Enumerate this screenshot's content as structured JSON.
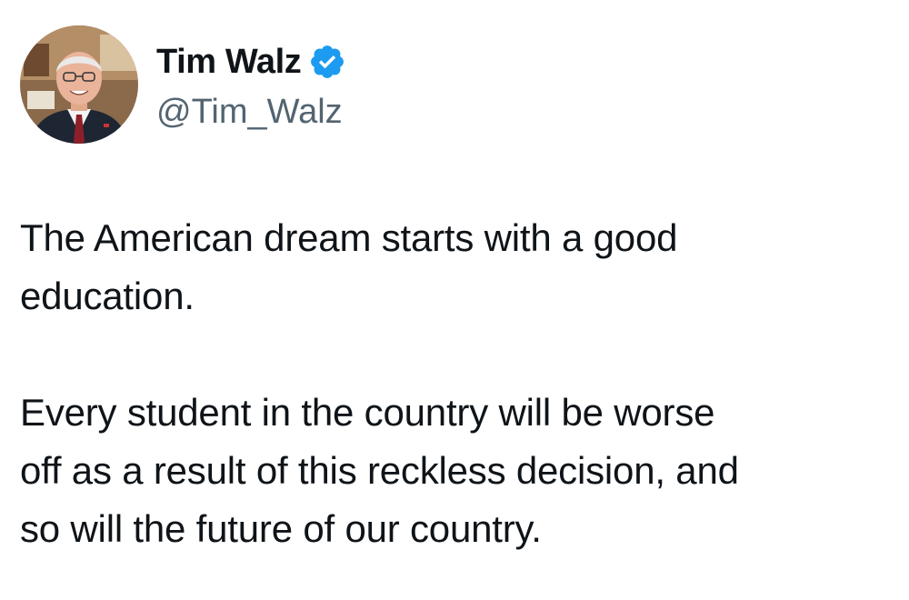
{
  "author": {
    "display_name": "Tim Walz",
    "handle": "@Tim_Walz",
    "verified_icon": "verified-badge-icon",
    "avatar_icon": "profile-photo"
  },
  "tweet": {
    "paragraphs": [
      "The American dream starts with a good\neducation.",
      "Every student in the country will be worse\noff as a result of this reckless decision, and\nso will the future of our country."
    ]
  },
  "colors": {
    "text": "#0f1419",
    "handle": "#536471",
    "verified": "#1d9bf0",
    "background": "#ffffff"
  }
}
